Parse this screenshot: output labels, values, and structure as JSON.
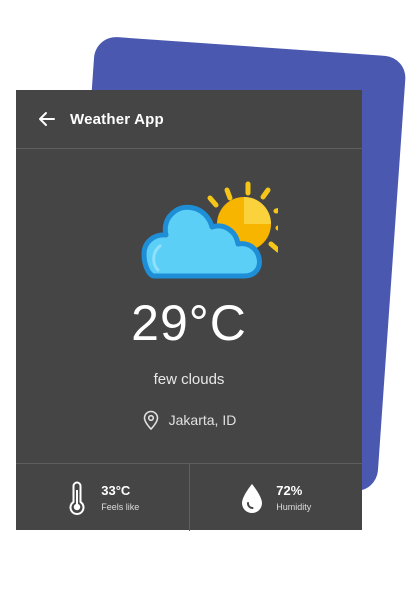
{
  "header": {
    "title": "Weather App",
    "back_icon": "arrow-left-icon"
  },
  "current": {
    "icon": "partly-cloudy-icon",
    "temperature": "29°C",
    "description": "few clouds",
    "location": "Jakarta, ID",
    "location_icon": "location-pin-icon"
  },
  "stats": [
    {
      "icon": "thermometer-icon",
      "value": "33°C",
      "label": "Feels like"
    },
    {
      "icon": "droplet-icon",
      "value": "72%",
      "label": "Humidity"
    }
  ],
  "colors": {
    "back_card": "#4a58b0",
    "panel": "#454545",
    "sun": "#f5c518",
    "cloud": "#55c8f5",
    "cloud_outline": "#1e8fd6"
  }
}
